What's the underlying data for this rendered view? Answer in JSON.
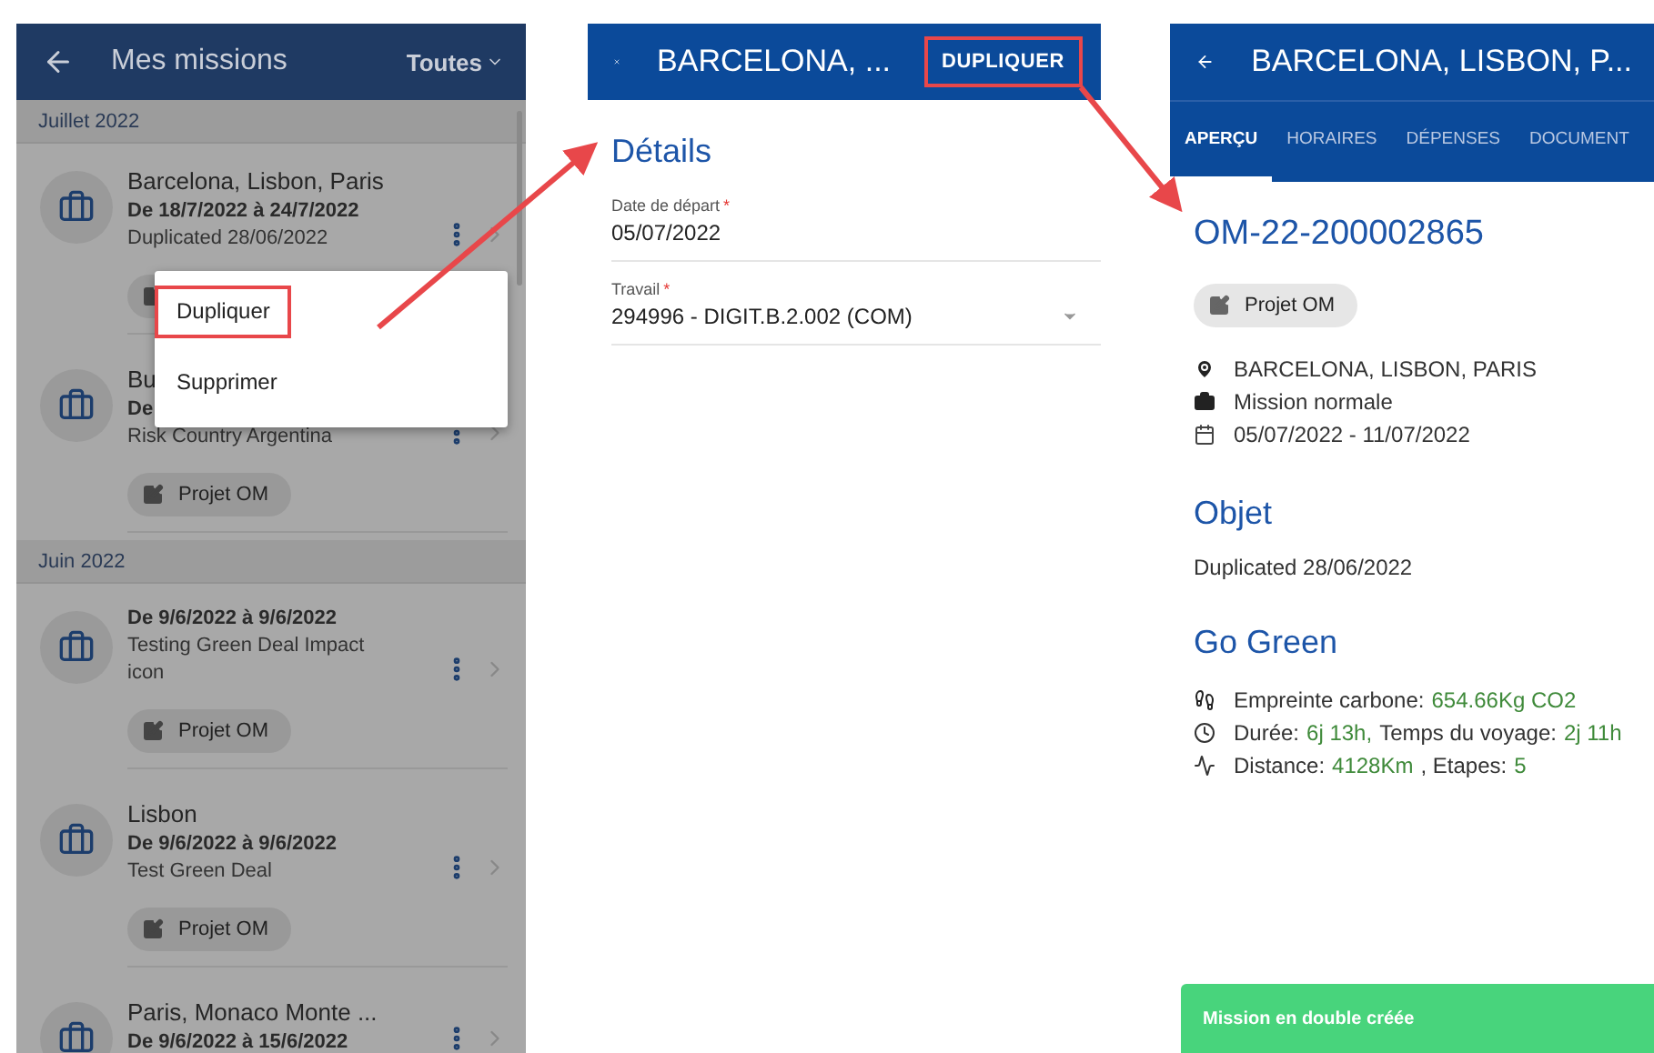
{
  "missions_screen": {
    "title": "Mes missions",
    "filter": "Toutes",
    "groups": [
      {
        "label": "Juillet 2022",
        "items": [
          {
            "title": "Barcelona, Lisbon, Paris",
            "dates": "De 18/7/2022 à 24/7/2022",
            "lines": [
              "Duplicated 28/06/2022"
            ],
            "chip": {
              "covered": true
            }
          },
          {
            "title": "Bu",
            "dates": "De",
            "lines": [
              "Risk Country Argentina"
            ],
            "chip": {
              "label": "Projet OM"
            }
          }
        ]
      },
      {
        "label": "Juin 2022",
        "items": [
          {
            "dates": "De 9/6/2022 à 9/6/2022",
            "lines": [
              "Testing Green Deal Impact",
              "icon"
            ],
            "chip": {
              "label": "Projet OM"
            }
          },
          {
            "title": "Lisbon",
            "dates": "De 9/6/2022 à 9/6/2022",
            "lines": [
              "Test Green Deal"
            ],
            "chip": {
              "label": "Projet OM"
            }
          },
          {
            "title": "Paris, Monaco Monte ...",
            "dates": "De 9/6/2022 à 15/6/2022"
          }
        ]
      }
    ],
    "menu": {
      "items": [
        {
          "label": "Dupliquer",
          "highlighted": true
        },
        {
          "label": "Supprimer",
          "highlighted": false
        }
      ]
    }
  },
  "form_screen": {
    "title": "BARCELONA, ...",
    "action": {
      "label": "DUPLIQUER",
      "highlighted": true
    },
    "section": "Détails",
    "fields": [
      {
        "kind": "text",
        "label": "Date de départ",
        "mark": "*",
        "value": "05/07/2022"
      },
      {
        "kind": "select",
        "label": "Travail",
        "mark": "*",
        "value": "294996 - DIGIT.B.2.002 (COM)"
      }
    ]
  },
  "detail_screen": {
    "title": "BARCELONA, LISBON, P...",
    "tabs": [
      {
        "label": "APERÇU",
        "selected": true
      },
      {
        "label": "HORAIRES",
        "selected": false
      },
      {
        "label": "DÉPENSES",
        "selected": false
      },
      {
        "label": "DOCUMENT",
        "selected": false
      }
    ],
    "reference": "OM-22-200002865",
    "chip": "Projet OM",
    "info": [
      {
        "kind": "place",
        "text": "BARCELONA, LISBON, PARIS"
      },
      {
        "kind": "type",
        "text": "Mission normale"
      },
      {
        "kind": "period",
        "text": "05/07/2022 - 11/07/2022"
      }
    ],
    "object_heading": "Objet",
    "object": "Duplicated 28/06/2022",
    "green_heading": "Go Green",
    "green": [
      {
        "kind": "footprint",
        "parts": [
          {
            "kind": "label",
            "text": "Empreinte carbone:"
          },
          {
            "kind": "value",
            "text": "654.66Kg CO2"
          }
        ]
      },
      {
        "kind": "time",
        "parts": [
          {
            "kind": "label",
            "text": "Durée:"
          },
          {
            "kind": "value",
            "text": "6j 13h,"
          },
          {
            "kind": "label",
            "text": "Temps du voyage:"
          },
          {
            "kind": "value",
            "text": "2j 11h"
          }
        ]
      },
      {
        "kind": "distance",
        "parts": [
          {
            "kind": "label",
            "text": "Distance:"
          },
          {
            "kind": "value",
            "text": "4128Km"
          },
          {
            "kind": "label",
            "text": ", Etapes:"
          },
          {
            "kind": "value",
            "text": "5"
          }
        ]
      }
    ],
    "toast": "Mission en double créée"
  }
}
